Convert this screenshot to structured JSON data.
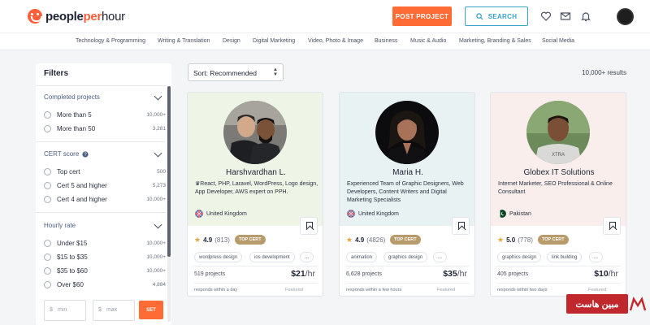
{
  "header": {
    "logo": {
      "people": "people",
      "per": "per",
      "hour": "hour"
    },
    "post_project": "POST PROJECT",
    "search": "SEARCH",
    "icons": [
      "heart-icon",
      "mail-icon",
      "bell-icon"
    ]
  },
  "categories": [
    "Technology & Programming",
    "Writing & Translation",
    "Design",
    "Digital Marketing",
    "Video, Photo & Image",
    "Business",
    "Music & Audio",
    "Marketing, Branding & Sales",
    "Social Media"
  ],
  "filters": {
    "title": "Filters",
    "completed": {
      "title": "Completed projects",
      "options": [
        {
          "label": "More than 5",
          "count": "10,000+"
        },
        {
          "label": "More than 50",
          "count": "3,281"
        }
      ]
    },
    "cert": {
      "title": "CERT score",
      "options": [
        {
          "label": "Top cert",
          "count": "500"
        },
        {
          "label": "Cert 5 and higher",
          "count": "5,273"
        },
        {
          "label": "Cert 4 and higher",
          "count": "10,000+"
        }
      ]
    },
    "hourly": {
      "title": "Hourly rate",
      "options": [
        {
          "label": "Under $15",
          "count": "10,000+"
        },
        {
          "label": "$15 to $35",
          "count": "10,000+"
        },
        {
          "label": "$35 to $60",
          "count": "10,000+"
        },
        {
          "label": "Over $60",
          "count": "4,884"
        }
      ]
    },
    "min": {
      "symbol": "$",
      "placeholder": "min"
    },
    "max": {
      "symbol": "$",
      "placeholder": "max"
    },
    "set": "SET"
  },
  "sort": {
    "label": "Sort: Recommended"
  },
  "results": "10,000+ results",
  "freelancers": [
    {
      "name": "Harshvardhan L.",
      "bio": "♛React, PHP, Laravel, WordPress, Logo design, App Developer, AWS expert on PPH.",
      "location": "United Kingdom",
      "rating": "4.9",
      "reviews": "(813)",
      "badge": "TOP CERT",
      "skills": [
        "wordpress design",
        "ios development",
        "..."
      ],
      "projects": "519 projects",
      "rate": "$21",
      "per": "/hr",
      "responds": "responds within a day",
      "featured": "Featured",
      "bg": "#eef4e6"
    },
    {
      "name": "Maria H.",
      "bio": "Experienced Team of Graphic Designers, Web Developers, Content Writers and Digital Marketing Specialists",
      "location": "United Kingdom",
      "rating": "4.9",
      "reviews": "(4826)",
      "badge": "TOP CERT",
      "skills": [
        "animation",
        "graphics design",
        "..."
      ],
      "projects": "6,628 projects",
      "rate": "$35",
      "per": "/hr",
      "responds": "responds within a few hours",
      "featured": "Featured",
      "bg": "#e9f2f3"
    },
    {
      "name": "Globex IT Solutions",
      "bio": "Internet Marketer, SEO Professional & Online Consultant",
      "location": "Pakistan",
      "rating": "5.0",
      "reviews": "(778)",
      "badge": "TOP CERT",
      "skills": [
        "graphics design",
        "link building",
        "..."
      ],
      "projects": "405 projects",
      "rate": "$10",
      "per": "/hr",
      "responds": "responds within two days",
      "featured": "Featured",
      "bg": "#f9eeec"
    }
  ],
  "watermark": "مبین هاست",
  "colors": {
    "accent": "#ff6b35",
    "search": "#3aa3c9",
    "badge": "#b89b6a",
    "star": "#e6a43a"
  }
}
